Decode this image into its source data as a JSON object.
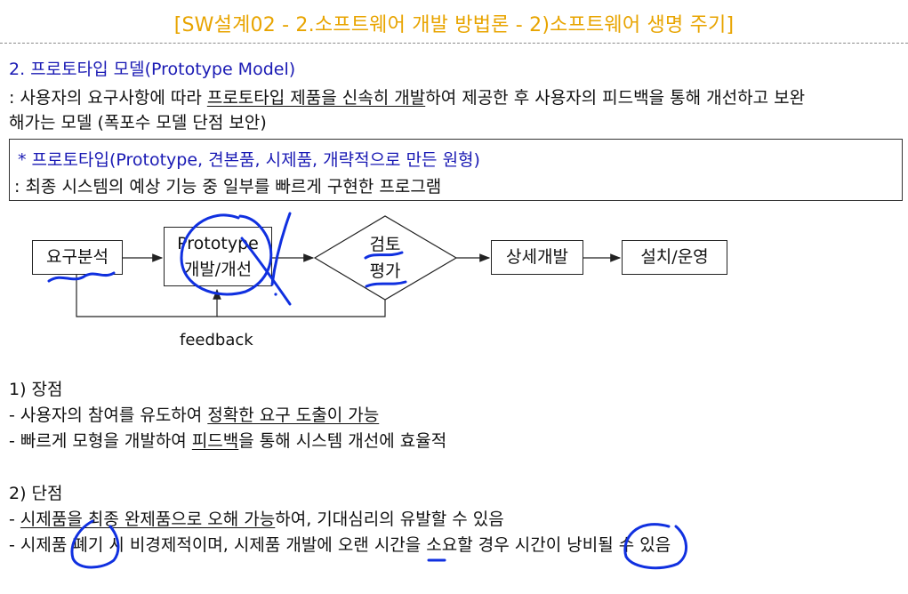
{
  "title": "[SW설계02 - 2.소프트웨어 개발 방법론 - 2)소프트웨어 생명 주기]",
  "section": {
    "heading": "2. 프로토타입 모델(Prototype Model)",
    "desc_pre": ": 사용자의 요구사항에 따라 ",
    "desc_underlined": "프로토타입 제품을 신속히 개발",
    "desc_post": "하여 제공한 후 사용자의 피드백을 통해 개선하고 보완",
    "desc_line2": "해가는 모델 (폭포수 모델 단점 보안)"
  },
  "definition": {
    "term": "* 프로토타입(Prototype, 견본품, 시제품, 개략적으로 만든 원형)",
    "meaning": ": 최종 시스템의 예상 기능 중 일부를 빠르게 구현한 프로그램"
  },
  "diagram": {
    "step1": "요구분석",
    "step2_line1": "Prototype",
    "step2_line2": "개발/개선",
    "step3_line1": "검토",
    "step3_line2": "평가",
    "step4": "상세개발",
    "step5": "설치/운영",
    "feedback": "feedback"
  },
  "pros": {
    "heading": "1) 장점",
    "item1_pre": "- 사용자의 참여를 유도하여 ",
    "item1_u": "정확한 요구 도출이 가능",
    "item2_pre": "- 빠르게 모형을 개발하여 ",
    "item2_u": "피드백",
    "item2_post": "을 통해 시스템 개선에 효율적"
  },
  "cons": {
    "heading": "2) 단점",
    "item1_dash": "- ",
    "item1_u": "시제품을 최종 완제품으로 오해 가능",
    "item1_post": "하여, 기대심리의 유발할 수 있음",
    "item2": "- 시제품 폐기 시 비경제적이며, 시제품 개발에 오랜 시간을 소요할 경우 시간이 낭비될 수 있음"
  },
  "colors": {
    "title": "#e8a400",
    "heading": "#1a1ab4",
    "annotation": "#1030e0"
  }
}
